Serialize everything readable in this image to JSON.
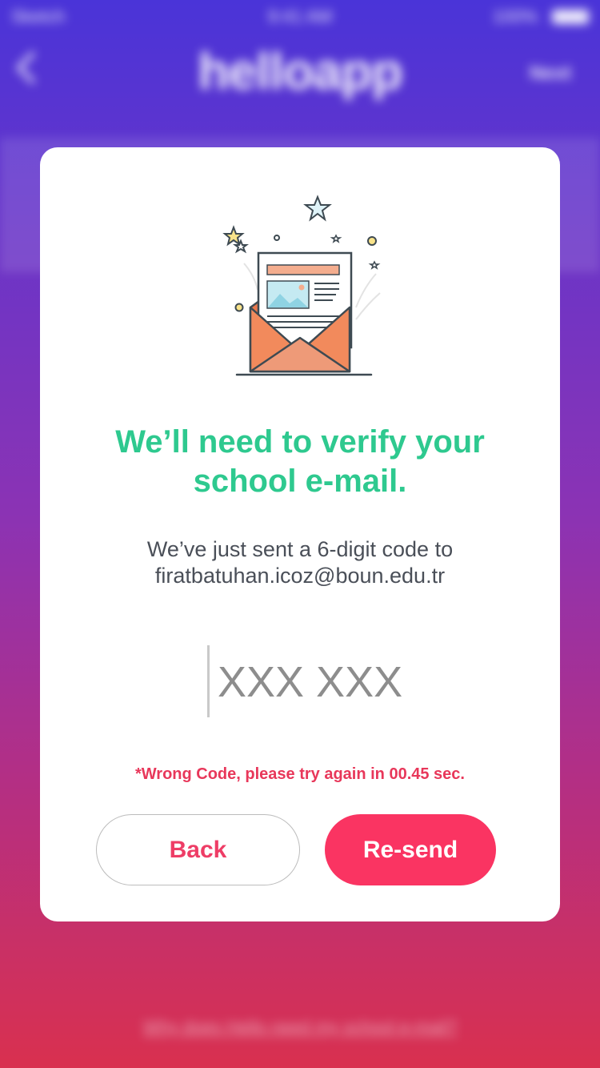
{
  "status_bar": {
    "carrier": "Sketch",
    "time": "9:41 AM",
    "battery": "100%"
  },
  "nav": {
    "title": "helloapp",
    "next_label": "Next"
  },
  "background_footer_link": "Why does Hello need my school e-mail?",
  "modal": {
    "headline": "We’ll need to verify your school e-mail.",
    "subtitle_line1": "We’ve just sent a 6-digit code to",
    "subtitle_line2": "firatbatuhan.icoz@boun.edu.tr",
    "code_placeholder": "XXX XXX",
    "code_value": "",
    "error_message": "*Wrong Code, please try again in 00.45 sec.",
    "back_label": "Back",
    "resend_label": "Re-send"
  },
  "colors": {
    "accent_green": "#2ec98f",
    "accent_pink": "#fa3462",
    "error_red": "#e8375a"
  }
}
